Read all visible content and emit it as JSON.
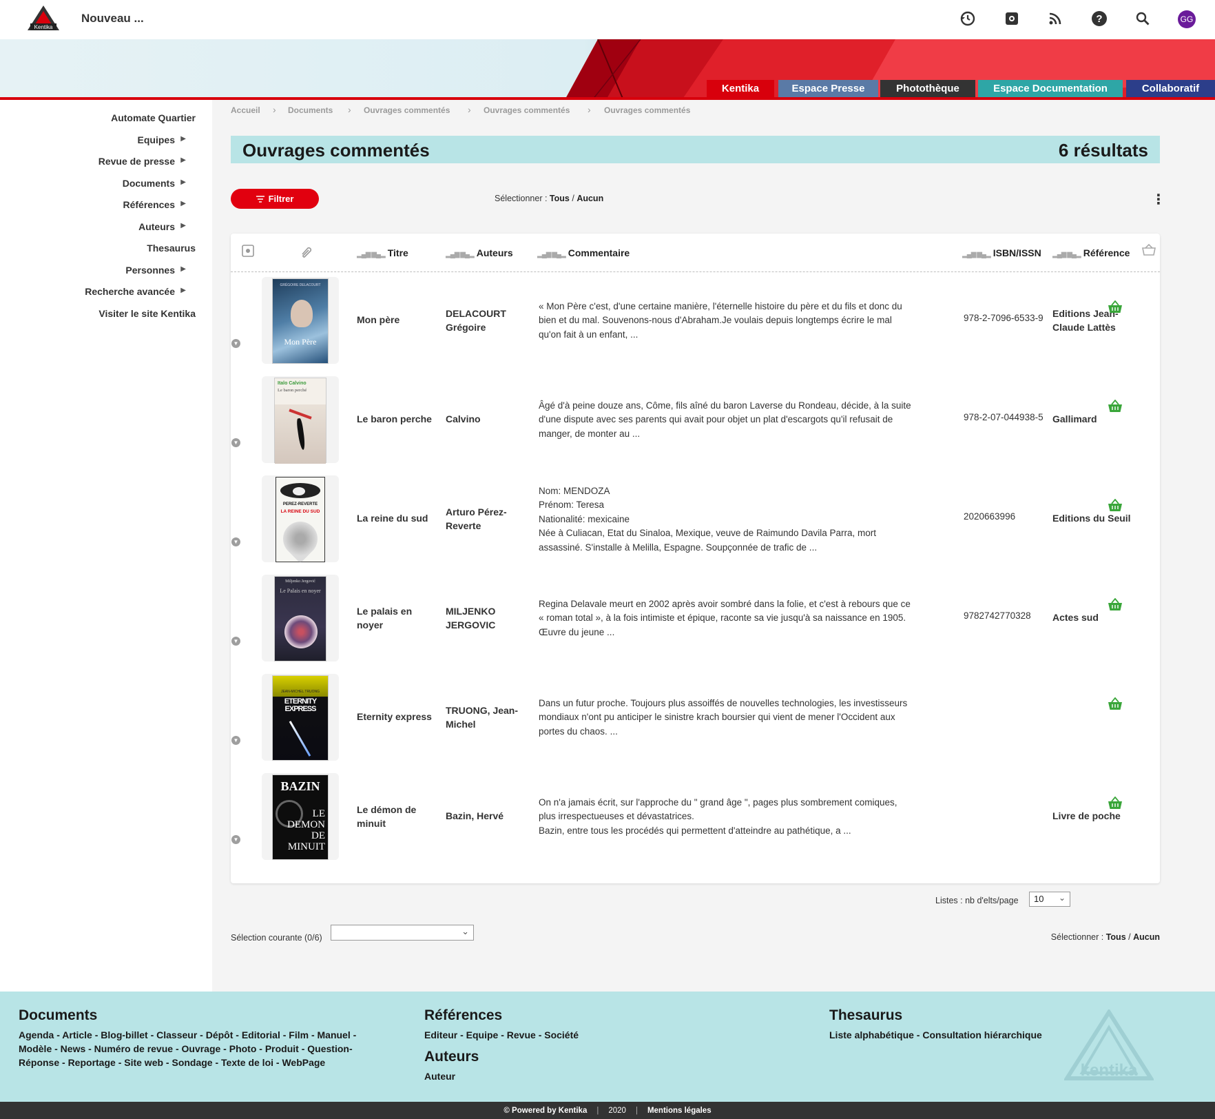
{
  "topbar": {
    "logo_text": "Kentika",
    "new_label": "Nouveau ...",
    "avatar_initials": "GG",
    "icons": [
      "history-icon",
      "gear-icon",
      "rss-icon",
      "help-icon",
      "search-icon"
    ]
  },
  "sites": [
    {
      "label": "Kentika",
      "color": "#d8000c"
    },
    {
      "label": "Espace Presse",
      "color": "#5a7aa6"
    },
    {
      "label": "Photothèque",
      "color": "#333333"
    },
    {
      "label": "Espace Documentation",
      "color": "#2ea6a6"
    },
    {
      "label": "Collaboratif",
      "color": "#2c3e8a"
    }
  ],
  "sidebar": {
    "items": [
      {
        "label": "Automate Quartier",
        "arrow": ""
      },
      {
        "label": "Equipes",
        "arrow": "▶"
      },
      {
        "label": "Revue de presse",
        "arrow": "▶"
      },
      {
        "label": "Documents",
        "arrow": "▶"
      },
      {
        "label": "Références",
        "arrow": "▶"
      },
      {
        "label": "Auteurs",
        "arrow": "▶"
      },
      {
        "label": "Thesaurus",
        "arrow": ""
      },
      {
        "label": "Personnes",
        "arrow": "▶"
      },
      {
        "label": "Recherche avancée",
        "arrow": "▶"
      },
      {
        "label": "Visiter le site Kentika",
        "arrow": ""
      }
    ]
  },
  "breadcrumb": [
    "Accueil",
    "Documents",
    "Ouvrages commentés",
    "Ouvrages commentés",
    "Ouvrages commentés"
  ],
  "main": {
    "title": "Ouvrages commentés",
    "results": "6 résultats",
    "filter_label": "Filtrer",
    "select_prefix": "Sélectionner :",
    "select_all": "Tous",
    "select_sep": "/",
    "select_none": "Aucun"
  },
  "table": {
    "columns": {
      "titre": "Titre",
      "auteurs": "Auteurs",
      "commentaire": "Commentaire",
      "isbn": "ISBN/ISSN",
      "reference": "Référence"
    },
    "rows": [
      {
        "titre": "Mon père",
        "auteurs": "DELACOURT Grégoire",
        "commentaire": "« Mon Père c'est, d'une certaine manière, l'éternelle histoire du père et du fils et donc du bien et du mal. Souvenons-nous d'Abraham.Je voulais depuis longtemps écrire le mal qu'on fait à un enfant, ...",
        "isbn": "978-2-7096-6533-9",
        "reference": "Editions Jean-Claude Lattès",
        "cover_text": "Mon Père",
        "cover_top": "GRÉGOIRE DELACOURT"
      },
      {
        "titre": "Le baron perche",
        "auteurs": "Calvino",
        "commentaire": "Âgé d'à peine douze ans, Côme, fils aîné du baron Laverse du Rondeau, décide, à la suite d'une dispute avec ses parents qui avait pour objet un plat d'escargots qu'il refusait de manger, de monter au ...",
        "isbn": "978-2-07-044938-5",
        "reference": "Gallimard",
        "cover_text": "Le baron perché",
        "cover_top": "Italo Calvino"
      },
      {
        "titre": "La reine du sud",
        "auteurs": "Arturo Pérez-Reverte",
        "commentaire": "Nom: MENDOZA\nPrénom: Teresa\nNationalité: mexicaine\nNée à Culiacan, Etat du Sinaloa, Mexique, veuve de Raimundo Davila Parra, mort assassiné. S'installe à Melilla, Espagne. Soupçonnée de trafic de ...",
        "isbn": "2020663996",
        "reference": "Editions du Seuil",
        "cover_text": "LA REINE DU SUD",
        "cover_top": "PEREZ-REVERTE"
      },
      {
        "titre": "Le palais en noyer",
        "auteurs": "MILJENKO JERGOVIC",
        "commentaire": "Regina Delavale meurt en 2002 après avoir sombré dans la folie, et c'est à rebours que ce « roman total », à la fois intimiste et épique, raconte sa vie jusqu'à sa naissance en 1905. Œuvre du jeune ...",
        "isbn": "9782742770328",
        "reference": "Actes sud",
        "cover_text": "Le Palais en noyer",
        "cover_top": "Miljenko Jergović"
      },
      {
        "titre": "Eternity express",
        "auteurs": "TRUONG, Jean-Michel",
        "commentaire": "Dans un futur proche. Toujours plus assoiffés de nouvelles technologies, les investisseurs mondiaux n'ont pu anticiper le sinistre krach boursier qui vient de mener l'Occident aux portes du chaos. ...",
        "isbn": "",
        "reference": "",
        "cover_text": "ETERNITY EXPRESS",
        "cover_top": "JEAN-MICHEL TRUONG"
      },
      {
        "titre": "Le démon de minuit",
        "auteurs": "Bazin, Hervé",
        "commentaire": "On n'a jamais écrit, sur l'approche du \" grand âge \", pages plus sombrement comiques, plus irrespectueuses et dévastatrices.\nBazin, entre tous les procédés qui permettent d'atteindre au pathétique, a ...",
        "isbn": "",
        "reference": "Livre de poche",
        "cover_text": "LE DEMON DE MINUIT",
        "cover_top": "BAZIN"
      }
    ]
  },
  "pagination": {
    "label": "Listes : nb d'elts/page",
    "value": "10"
  },
  "selection": {
    "label": "Sélection courante (0/6)"
  },
  "footer": {
    "documents_title": "Documents",
    "documents_links": "Agenda - Article - Blog-billet - Classeur - Dépôt - Editorial - Film - Manuel - Modèle - News - Numéro de revue - Ouvrage - Photo - Produit - Question-Réponse - Reportage - Site web - Sondage - Texte de loi - WebPage",
    "references_title": "Références",
    "references_links": "Editeur - Equipe - Revue - Société",
    "auteurs_title": "Auteurs",
    "auteurs_links": "Auteur",
    "thesaurus_title": "Thesaurus",
    "thesaurus_links": "Liste alphabétique - Consultation hiérarchique",
    "watermark": "kentika"
  },
  "bottombar": {
    "powered": "© Powered by Kentika",
    "year": "2020",
    "legal": "Mentions légales",
    "sep": "|"
  },
  "colors": {
    "accent": "#e1000f",
    "teal": "#b8e4e6",
    "basket": "#3aa63a"
  }
}
